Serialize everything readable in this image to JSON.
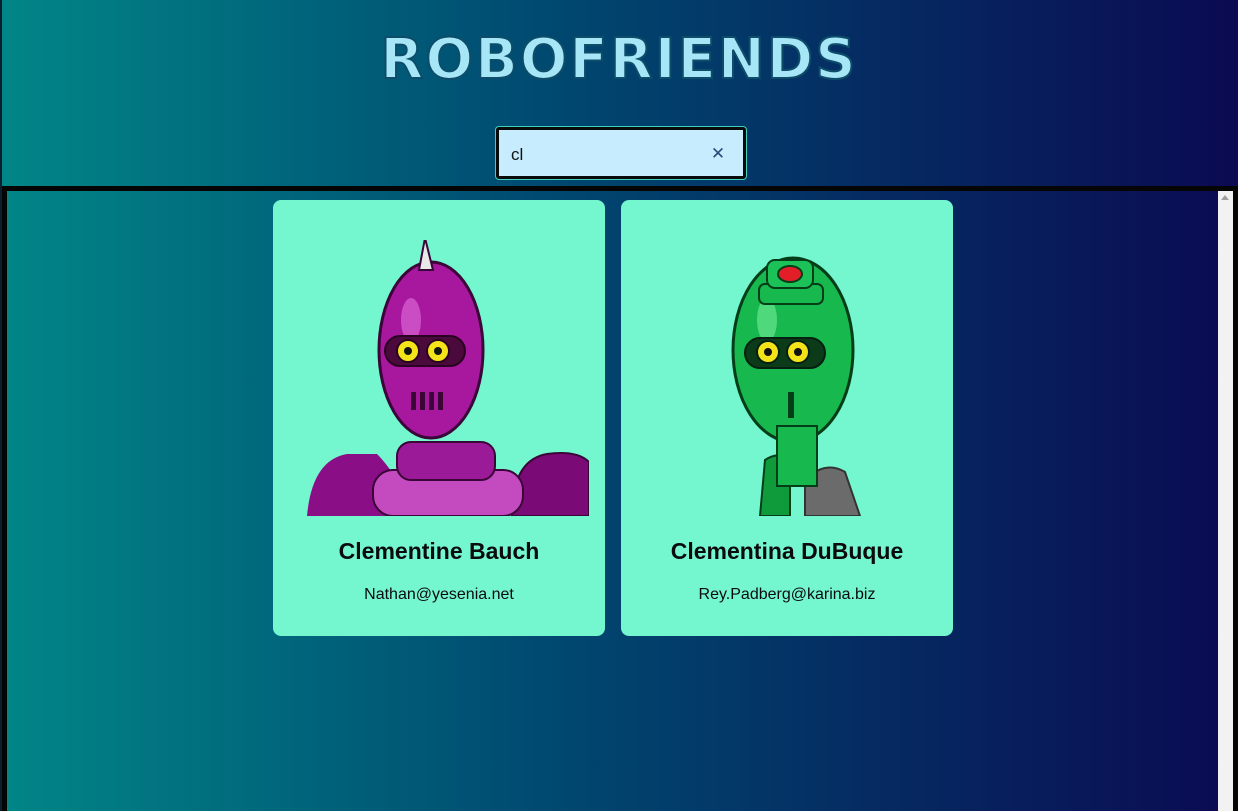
{
  "app": {
    "title": "ROBOFRIENDS"
  },
  "search": {
    "value": "cl",
    "clear_icon": "close-icon"
  },
  "robots": [
    {
      "name": "Clementine Bauch",
      "email": "Nathan@yesenia.net",
      "color": "#a0159c"
    },
    {
      "name": "Clementina DuBuque",
      "email": "Rey.Padberg@karina.biz",
      "color": "#16b84a"
    }
  ],
  "colors": {
    "card": "#74f6cf",
    "search_bg": "#c6ecfd",
    "title": "#a7e6f7"
  }
}
